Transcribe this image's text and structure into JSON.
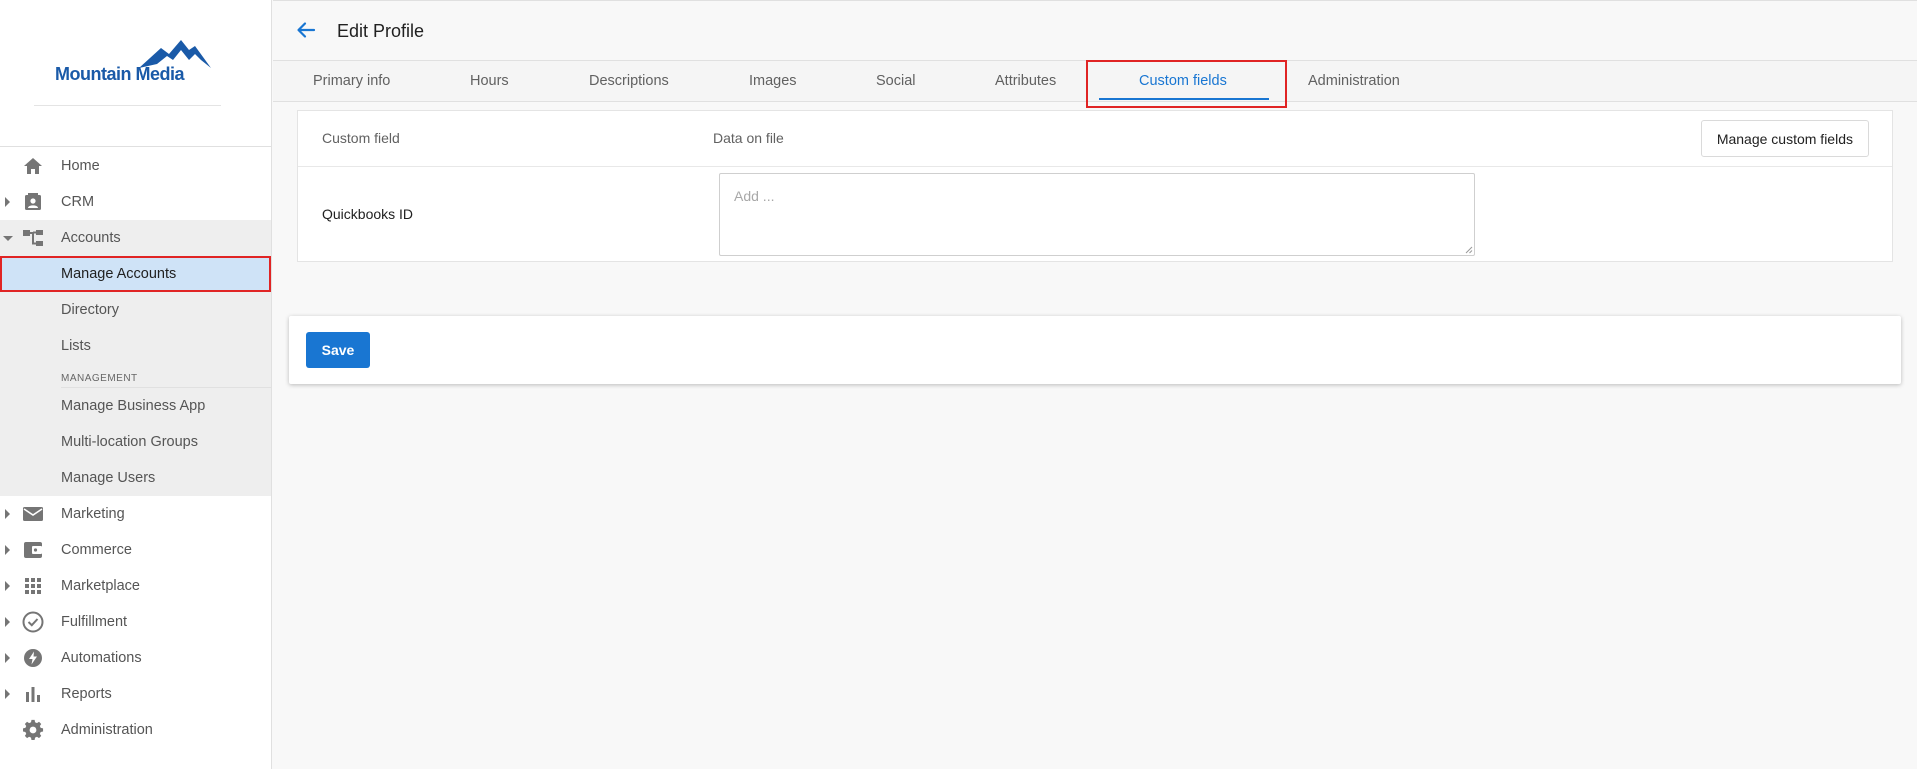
{
  "brand": {
    "name": "Mountain Media",
    "color": "#1a5aa8"
  },
  "header": {
    "title": "Edit Profile"
  },
  "tabs": [
    {
      "label": "Primary info"
    },
    {
      "label": "Hours"
    },
    {
      "label": "Descriptions"
    },
    {
      "label": "Images"
    },
    {
      "label": "Social"
    },
    {
      "label": "Attributes"
    },
    {
      "label": "Custom fields",
      "active": true
    },
    {
      "label": "Administration"
    }
  ],
  "sidebar": {
    "items": [
      {
        "label": "Home",
        "icon": "home-icon"
      },
      {
        "label": "CRM",
        "icon": "contact-card-icon"
      },
      {
        "label": "Accounts",
        "icon": "hierarchy-icon",
        "expanded": true
      },
      {
        "label": "Marketing",
        "icon": "mail-icon"
      },
      {
        "label": "Commerce",
        "icon": "wallet-icon"
      },
      {
        "label": "Marketplace",
        "icon": "grid-icon"
      },
      {
        "label": "Fulfillment",
        "icon": "check-circle-icon"
      },
      {
        "label": "Automations",
        "icon": "bolt-icon"
      },
      {
        "label": "Reports",
        "icon": "bar-chart-icon"
      },
      {
        "label": "Administration",
        "icon": "gear-icon"
      }
    ],
    "accounts_children": [
      {
        "label": "Manage Accounts",
        "active": true
      },
      {
        "label": "Directory"
      },
      {
        "label": "Lists"
      }
    ],
    "management_header": "MANAGEMENT",
    "management_children": [
      {
        "label": "Manage Business App"
      },
      {
        "label": "Multi-location Groups"
      },
      {
        "label": "Manage Users"
      }
    ]
  },
  "custom_fields": {
    "col_field": "Custom field",
    "col_data": "Data on file",
    "manage_label": "Manage custom fields",
    "rows": [
      {
        "label": "Quickbooks ID",
        "value": "",
        "placeholder": "Add ..."
      }
    ]
  },
  "actions": {
    "save_label": "Save"
  },
  "colors": {
    "accent": "#1976d2",
    "highlight": "#e02424",
    "active_bg": "#cfe3f7"
  }
}
